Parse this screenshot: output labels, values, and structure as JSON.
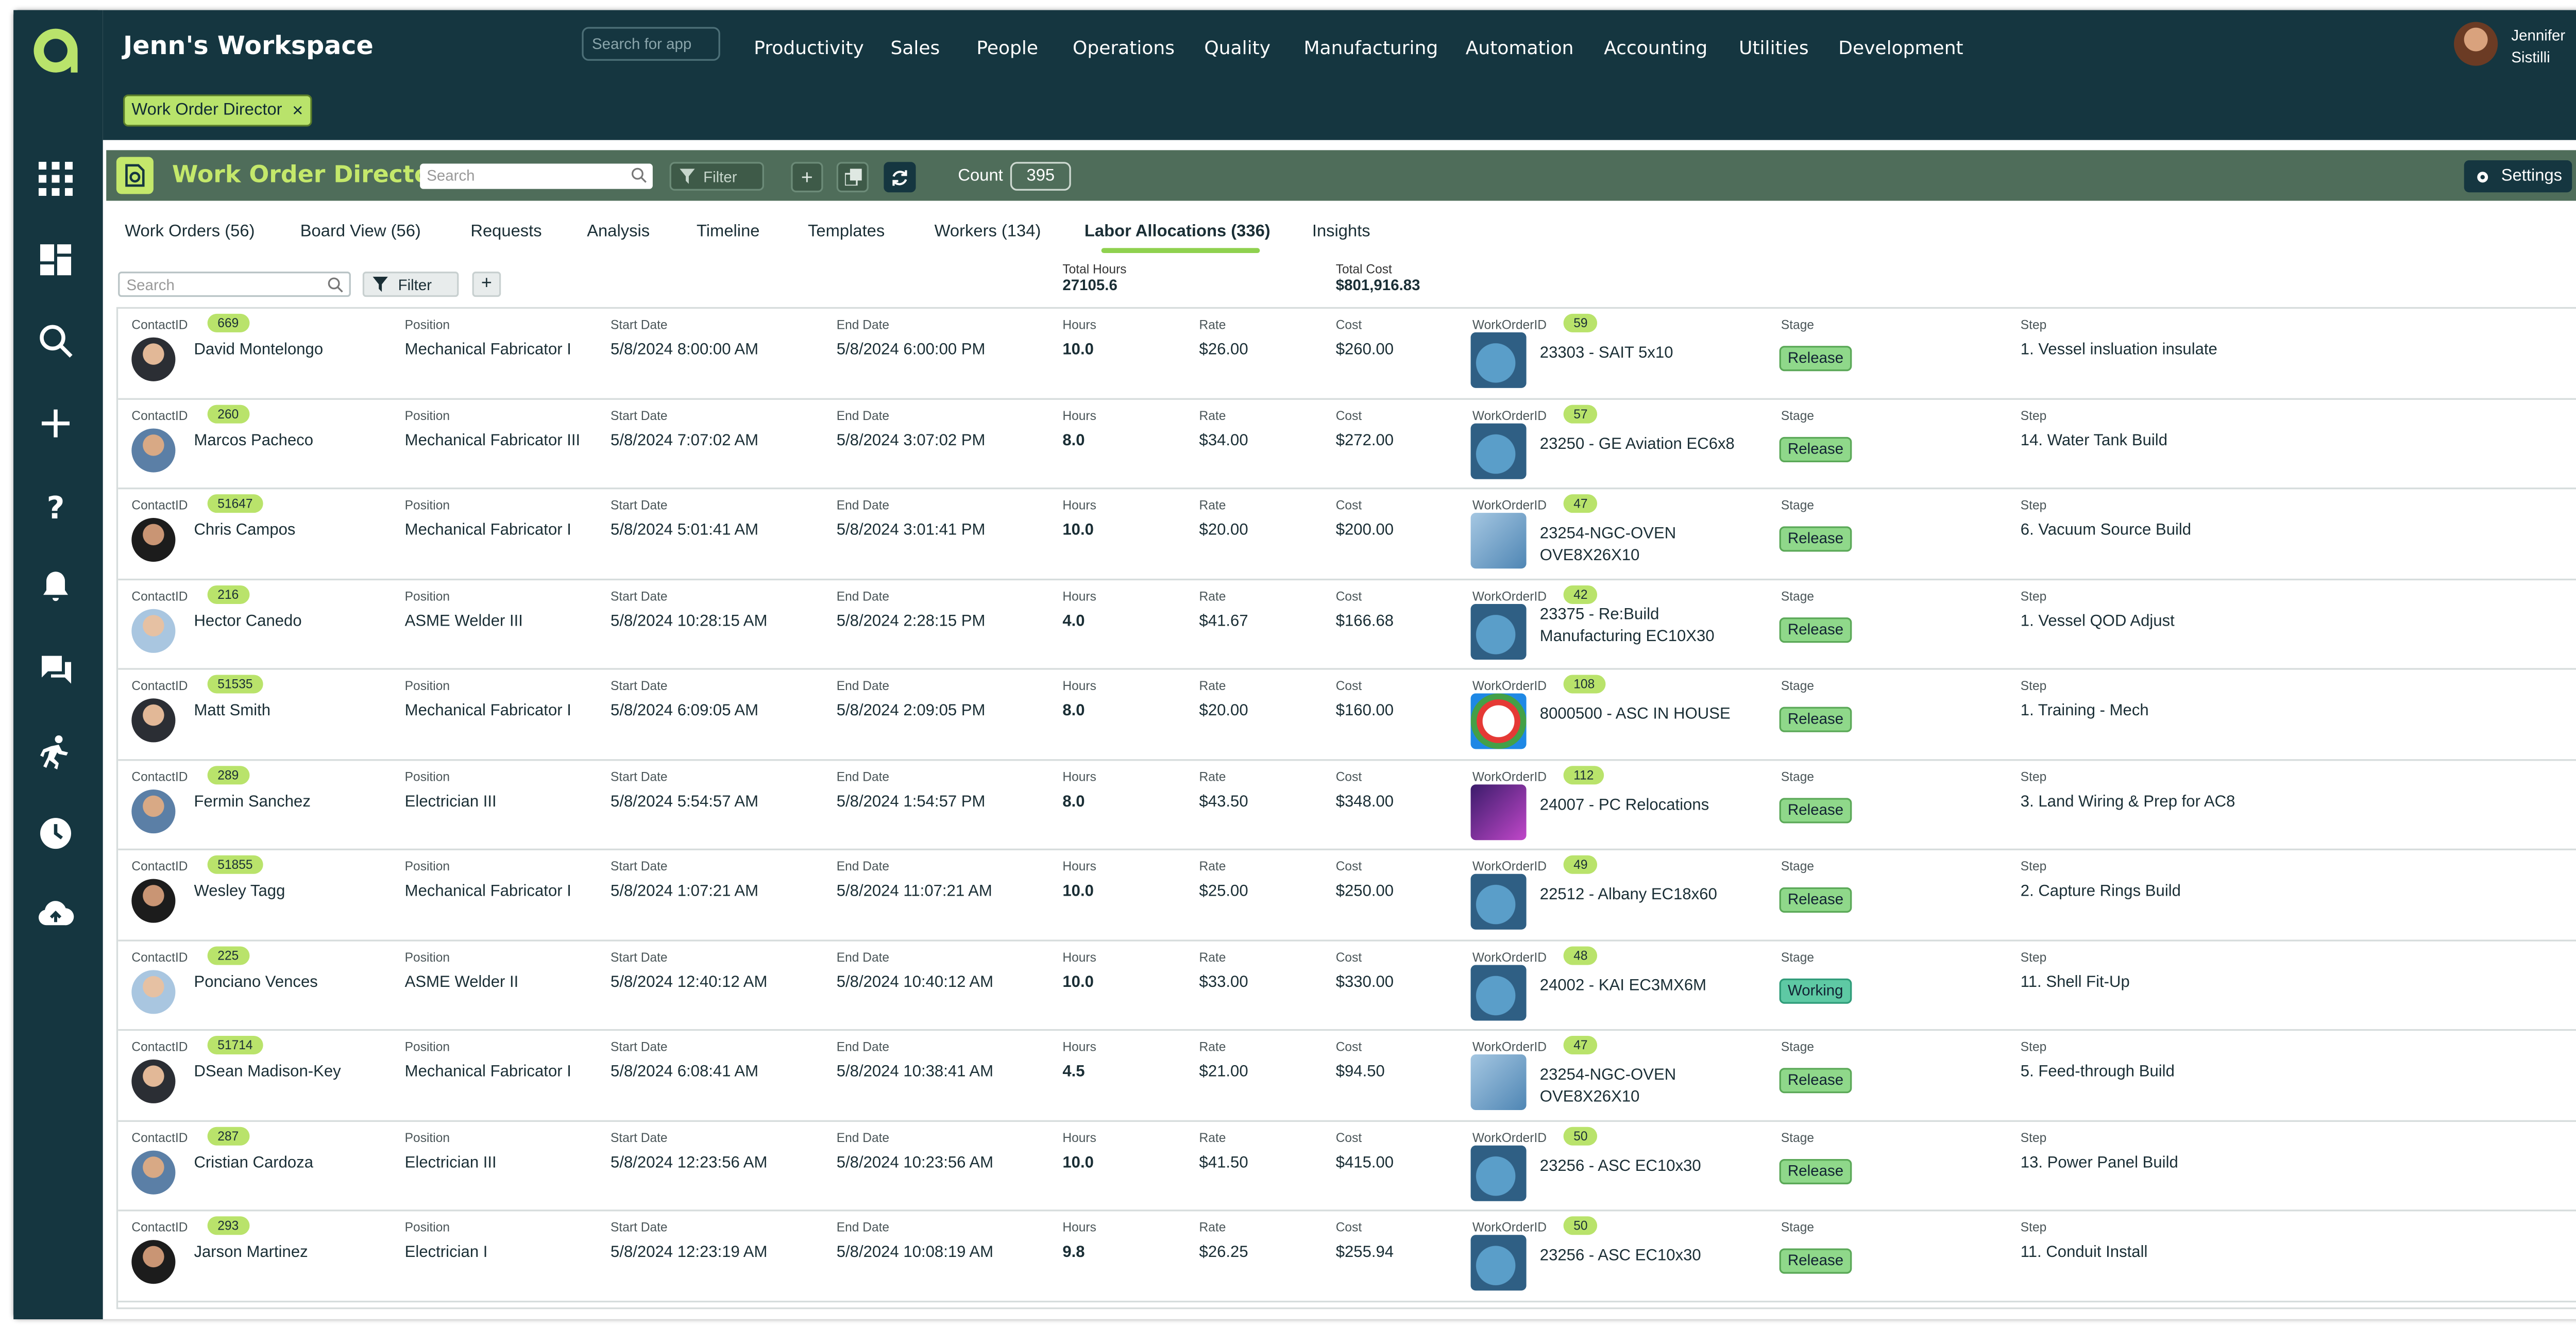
{
  "workspace": {
    "title": "Jenn's Workspace",
    "search_placeholder": "Search for app"
  },
  "nav": [
    "Productivity",
    "Sales",
    "People",
    "Operations",
    "Quality",
    "Manufacturing",
    "Automation",
    "Accounting",
    "Utilities",
    "Development"
  ],
  "user": {
    "first": "Jennifer",
    "last": "Sistilli"
  },
  "open_app_chip": {
    "label": "Work Order Director",
    "close": "×"
  },
  "app": {
    "title": "Work Order Director",
    "search_placeholder": "Search",
    "filter_label": "Filter",
    "count_label": "Count",
    "count": "395",
    "settings_label": "Settings",
    "help": "?"
  },
  "tabs": [
    "Work Orders (56)",
    "Board View (56)",
    "Requests",
    "Analysis",
    "Timeline",
    "Templates",
    "Workers (134)",
    "Labor Allocations (336)",
    "Insights"
  ],
  "active_tab": "Labor Allocations (336)",
  "sub": {
    "search_placeholder": "Search",
    "filter_label": "Filter",
    "plus": "+"
  },
  "totals": {
    "hours_label": "Total Hours",
    "hours": "27105.6",
    "cost_label": "Total Cost",
    "cost": "$801,916.83"
  },
  "columns": {
    "contact": "ContactID",
    "position": "Position",
    "start": "Start Date",
    "end": "End Date",
    "hours": "Hours",
    "rate": "Rate",
    "cost": "Cost",
    "wo": "WorkOrderID",
    "stage": "Stage",
    "step": "Step"
  },
  "rows": [
    {
      "contact_id": "669",
      "name": "David Montelongo",
      "position": "Mechanical Fabricator I",
      "start": "5/8/2024 8:00:00 AM",
      "end": "5/8/2024 6:00:00 PM",
      "hours": "10.0",
      "rate": "$26.00",
      "cost": "$260.00",
      "wo_id": "59",
      "wo_name": "23303 - SAIT 5x10",
      "stage": "Release",
      "step": "1. Vessel insluation insulate"
    },
    {
      "contact_id": "260",
      "name": "Marcos Pacheco",
      "position": "Mechanical Fabricator III",
      "start": "5/8/2024 7:07:02 AM",
      "end": "5/8/2024 3:07:02 PM",
      "hours": "8.0",
      "rate": "$34.00",
      "cost": "$272.00",
      "wo_id": "57",
      "wo_name": "23250 - GE Aviation EC6x8",
      "stage": "Release",
      "step": "14. Water Tank Build"
    },
    {
      "contact_id": "51647",
      "name": "Chris Campos",
      "position": "Mechanical Fabricator I",
      "start": "5/8/2024 5:01:41 AM",
      "end": "5/8/2024 3:01:41 PM",
      "hours": "10.0",
      "rate": "$20.00",
      "cost": "$200.00",
      "wo_id": "47",
      "wo_name": "23254-NGC-OVEN OVE8X26X10",
      "stage": "Release",
      "step": "6. Vacuum Source Build"
    },
    {
      "contact_id": "216",
      "name": "Hector Canedo",
      "position": "ASME Welder III",
      "start": "5/8/2024 10:28:15 AM",
      "end": "5/8/2024 2:28:15 PM",
      "hours": "4.0",
      "rate": "$41.67",
      "cost": "$166.68",
      "wo_id": "42",
      "wo_name": "23375 - Re:Build Manufacturing EC10X30",
      "stage": "Release",
      "step": "1. Vessel QOD Adjust"
    },
    {
      "contact_id": "51535",
      "name": "Matt Smith",
      "position": "Mechanical Fabricator I",
      "start": "5/8/2024 6:09:05 AM",
      "end": "5/8/2024 2:09:05 PM",
      "hours": "8.0",
      "rate": "$20.00",
      "cost": "$160.00",
      "wo_id": "108",
      "wo_name": "8000500 - ASC IN HOUSE",
      "stage": "Release",
      "step": "1. Training - Mech"
    },
    {
      "contact_id": "289",
      "name": "Fermin Sanchez",
      "position": "Electrician III",
      "start": "5/8/2024 5:54:57 AM",
      "end": "5/8/2024 1:54:57 PM",
      "hours": "8.0",
      "rate": "$43.50",
      "cost": "$348.00",
      "wo_id": "112",
      "wo_name": "24007 - PC Relocations",
      "stage": "Release",
      "step": "3. Land Wiring & Prep for AC8"
    },
    {
      "contact_id": "51855",
      "name": "Wesley Tagg",
      "position": "Mechanical Fabricator I",
      "start": "5/8/2024 1:07:21 AM",
      "end": "5/8/2024 11:07:21 AM",
      "hours": "10.0",
      "rate": "$25.00",
      "cost": "$250.00",
      "wo_id": "49",
      "wo_name": "22512 - Albany EC18x60",
      "stage": "Release",
      "step": "2. Capture Rings Build"
    },
    {
      "contact_id": "225",
      "name": "Ponciano Vences",
      "position": "ASME Welder II",
      "start": "5/8/2024 12:40:12 AM",
      "end": "5/8/2024 10:40:12 AM",
      "hours": "10.0",
      "rate": "$33.00",
      "cost": "$330.00",
      "wo_id": "48",
      "wo_name": "24002 - KAI EC3MX6M",
      "stage": "Working",
      "step": "11. Shell Fit-Up"
    },
    {
      "contact_id": "51714",
      "name": "DSean  Madison-Key",
      "position": "Mechanical Fabricator I",
      "start": "5/8/2024 6:08:41 AM",
      "end": "5/8/2024 10:38:41 AM",
      "hours": "4.5",
      "rate": "$21.00",
      "cost": "$94.50",
      "wo_id": "47",
      "wo_name": "23254-NGC-OVEN OVE8X26X10",
      "stage": "Release",
      "step": "5. Feed-through Build"
    },
    {
      "contact_id": "287",
      "name": "Cristian Cardoza",
      "position": "Electrician III",
      "start": "5/8/2024 12:23:56 AM",
      "end": "5/8/2024 10:23:56 AM",
      "hours": "10.0",
      "rate": "$41.50",
      "cost": "$415.00",
      "wo_id": "50",
      "wo_name": "23256 - ASC EC10x30",
      "stage": "Release",
      "step": "13. Power Panel Build"
    },
    {
      "contact_id": "293",
      "name": "Jarson Martinez",
      "position": "Electrician I",
      "start": "5/8/2024 12:23:19 AM",
      "end": "5/8/2024 10:08:19 AM",
      "hours": "9.8",
      "rate": "$26.25",
      "cost": "$255.94",
      "wo_id": "50",
      "wo_name": "23256 - ASC EC10x30",
      "stage": "Release",
      "step": "11. Conduit Install"
    }
  ],
  "colors": {
    "navy": "#153640",
    "lime": "#c4e86b",
    "app_header": "#4f6d5a",
    "release": "#8fd88a",
    "working": "#5ec9a4"
  }
}
